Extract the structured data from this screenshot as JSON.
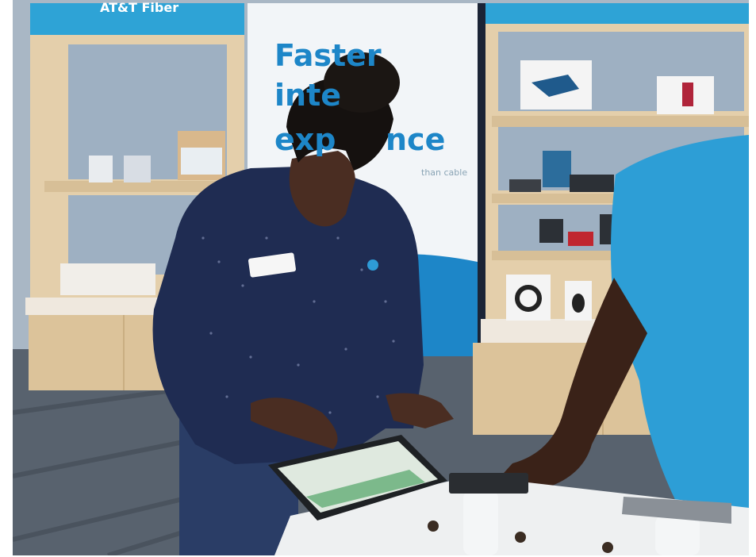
{
  "scene": {
    "banner_lines": [
      "Faster",
      "inte",
      "exp",
      "nce"
    ],
    "banner_subtext": "than cable",
    "top_sign_text": "AT&T Fiber"
  },
  "colors": {
    "wall": "#aab8c6",
    "shelf_wood": "#e8d3b0",
    "banner_blue": "#1d86c8",
    "shirt_navy": "#1f2c52",
    "shirt_blue": "#2d9ed6",
    "carpet": "#5a6470"
  }
}
